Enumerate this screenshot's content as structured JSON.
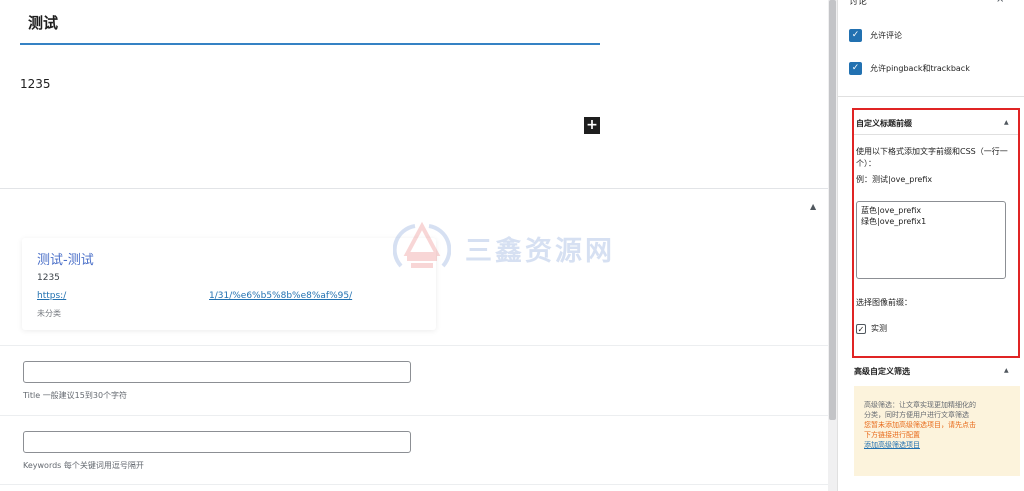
{
  "editor": {
    "post_title": "测试",
    "post_body": "1235",
    "add_block_symbol": "+",
    "collapse_symbol": "▲",
    "preview": {
      "title": "测试-测试",
      "excerpt": "1235",
      "link_part_a": "https:/",
      "link_part_b": "1/31/%e6%b5%8b%e8%af%95/",
      "category": "未分类"
    },
    "title_field": {
      "value": "",
      "hint": "Title 一般建议15到30个字符"
    },
    "keywords_field": {
      "value": "",
      "hint": "Keywords 每个关键词用逗号隔开"
    }
  },
  "watermark": {
    "text": "三鑫资源网",
    "colors": {
      "red": "#e04a4a",
      "blue": "#4a78c8"
    }
  },
  "sidebar": {
    "discussion": {
      "title": "讨论",
      "close_symbol": "×",
      "allow_comments": {
        "label": "允许评论",
        "checked": true
      },
      "allow_pingbacks": {
        "label": "允许pingback和trackback",
        "checked": true
      }
    },
    "title_prefix": {
      "heading": "自定义标题前缀",
      "collapse_symbol": "▲",
      "description": "使用以下格式添加文字前缀和CSS（一行一个）：",
      "example": "例：测试|ove_prefix",
      "textarea_lines": [
        "蓝色|ove_prefix",
        "绿色|ove_prefix1"
      ],
      "image_prefix_label": "选择图像前缀：",
      "test_option": {
        "label": "实测",
        "checked": true
      }
    },
    "advanced_filter": {
      "heading": "高级自定义筛选",
      "collapse_symbol": "▲",
      "line1": "高级筛选：让文章实现更加精细化的",
      "line2": "分类，同时方便用户进行文章筛选",
      "line3": "您暂未添加高级筛选项目，请先点击",
      "line4": "下方链接进行配置",
      "link": "添加高级筛选项目"
    }
  },
  "colors": {
    "accent": "#2271b1",
    "highlight_border": "#e02424",
    "notice_bg": "#fcf3dc",
    "warning_text": "#e86a1a"
  }
}
